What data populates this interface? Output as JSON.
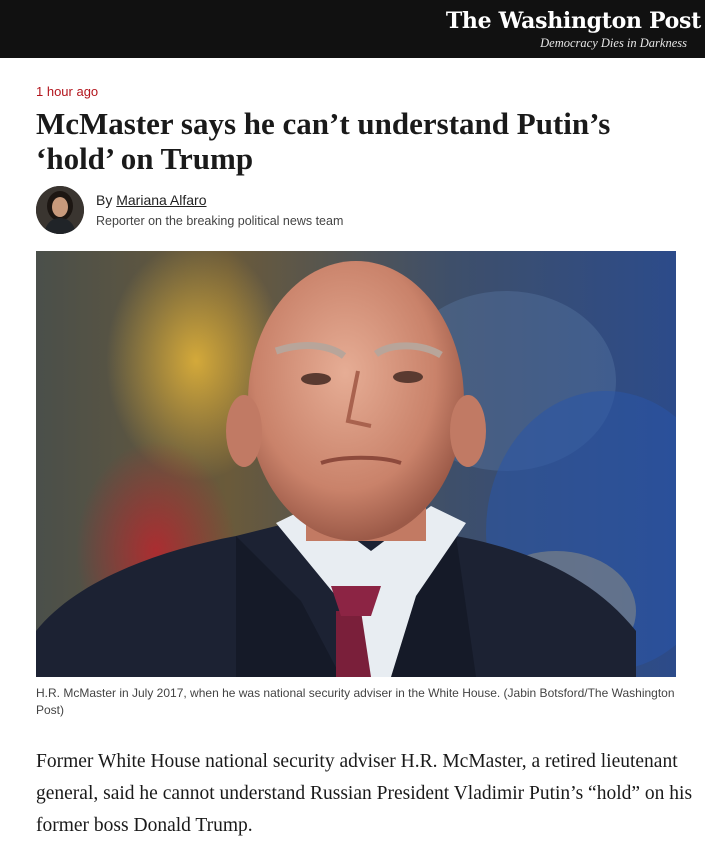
{
  "masthead": {
    "logo": "The Washington Post",
    "tagline": "Democracy Dies in Darkness"
  },
  "article": {
    "timestamp": "1 hour ago",
    "headline": "McMaster says he can’t understand Putin’s ‘hold’ on Trump",
    "byline_prefix": "By ",
    "author": "Mariana Alfaro",
    "author_description": "Reporter on the breaking political news team",
    "photo_alt": "H.R. McMaster",
    "caption": "H.R. McMaster in July 2017, when he was national security adviser in the White House. (Jabin Botsford/The Washington Post)",
    "lede": "Former White House national security adviser H.R. McMaster, a retired lieutenant general, said he cannot understand Russian President Vladimir Putin’s “hold” on his former boss Donald Trump."
  },
  "colors": {
    "topbar_bg": "#111111",
    "timestamp": "#b3151d",
    "text": "#1a1a1a"
  }
}
